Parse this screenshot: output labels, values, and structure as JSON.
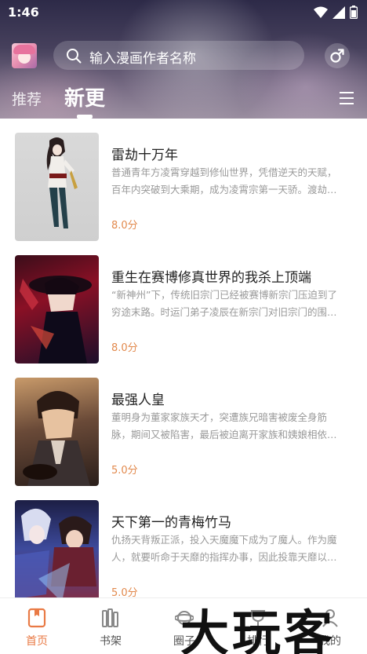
{
  "status_bar": {
    "time": "1:46"
  },
  "search": {
    "placeholder": "输入漫画作者名称"
  },
  "tabs": [
    {
      "label": "推荐",
      "active": false
    },
    {
      "label": "新更",
      "active": true
    }
  ],
  "list": [
    {
      "title": "雷劫十万年",
      "desc": "普通青年方凌霄穿越到修仙世界，凭借逆天的天赋，百年内突破到大乘期，成为凌霄宗第一天骄。渡劫…",
      "score": "8.0分"
    },
    {
      "title": "重生在赛博修真世界的我杀上顶端",
      "desc": "“新神州”下，传统旧宗门已经被赛博新宗门压迫到了穷途末路。时运门弟子凌辰在新宗门对旧宗门的围…",
      "score": "8.0分"
    },
    {
      "title": "最强人皇",
      "desc": "董明身为董家家族天才，突遭族兄暗害被废全身筋脉，期间又被陷害，最后被迫离开家族和姨娘相依…",
      "score": "5.0分"
    },
    {
      "title": "天下第一的青梅竹马",
      "desc": "仇扬天背叛正派，投入天魔魔下成为了魔人。作为魔人，就要听命于天靡的指挥办事，因此投靠天靡以…",
      "score": "5.0分"
    }
  ],
  "bottom_nav": [
    {
      "label": "首页",
      "icon": "home-icon",
      "active": true
    },
    {
      "label": "书架",
      "icon": "bookshelf-icon",
      "active": false
    },
    {
      "label": "圈子",
      "icon": "planet-icon",
      "active": false
    },
    {
      "label": "排行",
      "icon": "rank-icon",
      "active": false
    },
    {
      "label": "我的",
      "icon": "profile-icon",
      "active": false
    }
  ],
  "watermark": "大玩客",
  "colors": {
    "accent": "#e97a45",
    "score": "#e28a4e"
  }
}
